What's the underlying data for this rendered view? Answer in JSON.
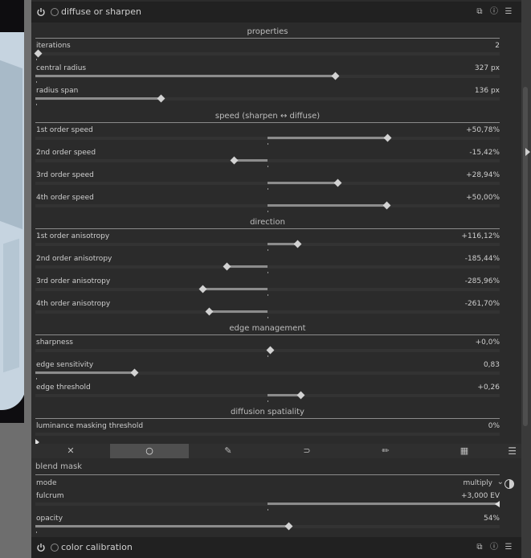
{
  "module": {
    "title": "diffuse or sharpen",
    "sections": {
      "properties": "properties",
      "speed": "speed (sharpen ↔ diffuse)",
      "direction": "direction",
      "edge": "edge management",
      "spatiality": "diffusion spatiality"
    },
    "sliders": [
      {
        "label": "iterations",
        "value": "2",
        "fraction": 0.0
      },
      {
        "label": "central radius",
        "value": "327 px",
        "fraction": 0.64
      },
      {
        "label": "radius span",
        "value": "136 px",
        "fraction": 0.265
      },
      {
        "label": "1st order speed",
        "value": "+50,78%",
        "position": 0.753
      },
      {
        "label": "2nd order speed",
        "value": "-15,42%",
        "position": 0.423
      },
      {
        "label": "3rd order speed",
        "value": "+28,94%",
        "position": 0.645
      },
      {
        "label": "4th order speed",
        "value": "+50,00%",
        "position": 0.75
      },
      {
        "label": "1st order anisotropy",
        "value": "+116,12%",
        "position": 0.558
      },
      {
        "label": "2nd order anisotropy",
        "value": "-185,44%",
        "position": 0.406
      },
      {
        "label": "3rd order anisotropy",
        "value": "-285,96%",
        "position": 0.355
      },
      {
        "label": "4th order anisotropy",
        "value": "-261,70%",
        "position": 0.368
      },
      {
        "label": "sharpness",
        "value": "+0,0%",
        "position": 0.5
      },
      {
        "label": "edge sensitivity",
        "value": "0,83",
        "fraction": 0.207
      },
      {
        "label": "edge threshold",
        "value": "+0,26",
        "position": 0.565
      },
      {
        "label": "luminance masking threshold",
        "value": "0%",
        "fraction": 0.0
      }
    ]
  },
  "mask_tabs": [
    {
      "icon": "off-icon",
      "glyph": "✕"
    },
    {
      "icon": "uniform-icon",
      "glyph": "○"
    },
    {
      "icon": "drawn-mask-icon",
      "glyph": "✎"
    },
    {
      "icon": "parametric-mask-icon",
      "glyph": "⊃"
    },
    {
      "icon": "drawn-parametric-icon",
      "glyph": "✏"
    },
    {
      "icon": "raster-mask-icon",
      "glyph": "▦"
    }
  ],
  "blend": {
    "title": "blend mask",
    "mode_label": "mode",
    "mode_value": "multiply",
    "fulcrum_label": "fulcrum",
    "fulcrum_value": "+3,000 EV",
    "fulcrum_position": 1.0,
    "opacity_label": "opacity",
    "opacity_value": "54%",
    "opacity_fraction": 0.54
  },
  "next_module": {
    "title": "color calibration"
  }
}
